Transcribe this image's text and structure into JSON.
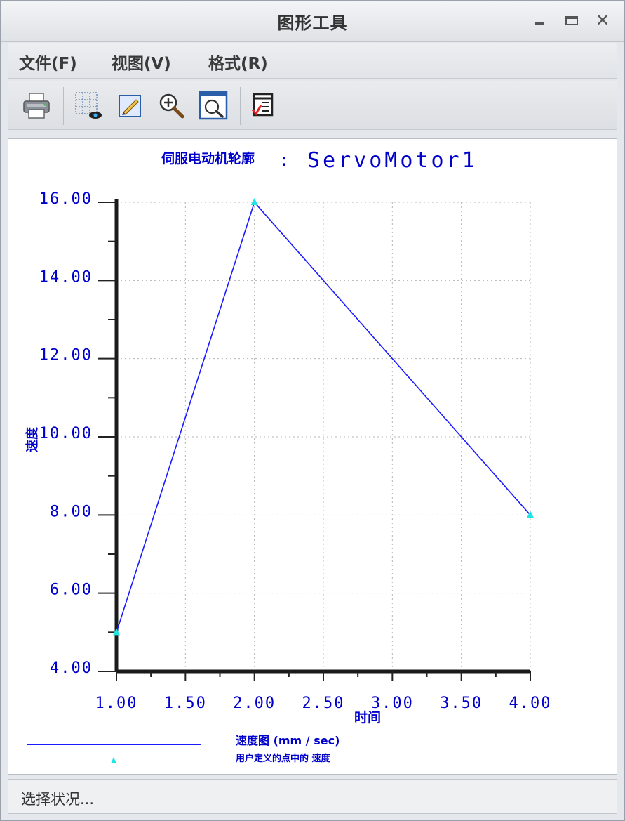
{
  "window": {
    "title": "图形工具",
    "controls": [
      "minimize",
      "maximize",
      "close"
    ],
    "close_glyph": "✕"
  },
  "menu": {
    "items": [
      "文件(F)",
      "视图(V)",
      "格式(R)"
    ]
  },
  "toolbar": {
    "buttons": [
      "printer-icon",
      "grid-view-icon",
      "edit-icon",
      "zoom-in-icon",
      "zoom-fit-icon",
      "format-check-icon"
    ]
  },
  "status": {
    "text": "选择状况..."
  },
  "chart_data": {
    "type": "line",
    "title_cn": "伺服电动机轮廓",
    "title_sep": ":",
    "title_name": "ServoMotor1",
    "xlabel": "时间",
    "ylabel": "速度",
    "x": [
      1.0,
      2.0,
      4.0
    ],
    "y": [
      5.0,
      16.0,
      8.0
    ],
    "xlim": [
      1.0,
      4.0
    ],
    "ylim": [
      4.0,
      16.0
    ],
    "xticks": [
      "1.00",
      "1.50",
      "2.00",
      "2.50",
      "3.00",
      "3.50",
      "4.00"
    ],
    "yticks": [
      "4.00",
      "6.00",
      "8.00",
      "10.00",
      "12.00",
      "14.00",
      "16.00"
    ],
    "grid": true,
    "line_color": "#1a1aff",
    "marker_color": "#1ee6e6",
    "axis_text_color": "#0000cc",
    "legend": {
      "line1": "速度图 (mm / sec)",
      "line2": "用户定义的点中的 速度"
    }
  }
}
